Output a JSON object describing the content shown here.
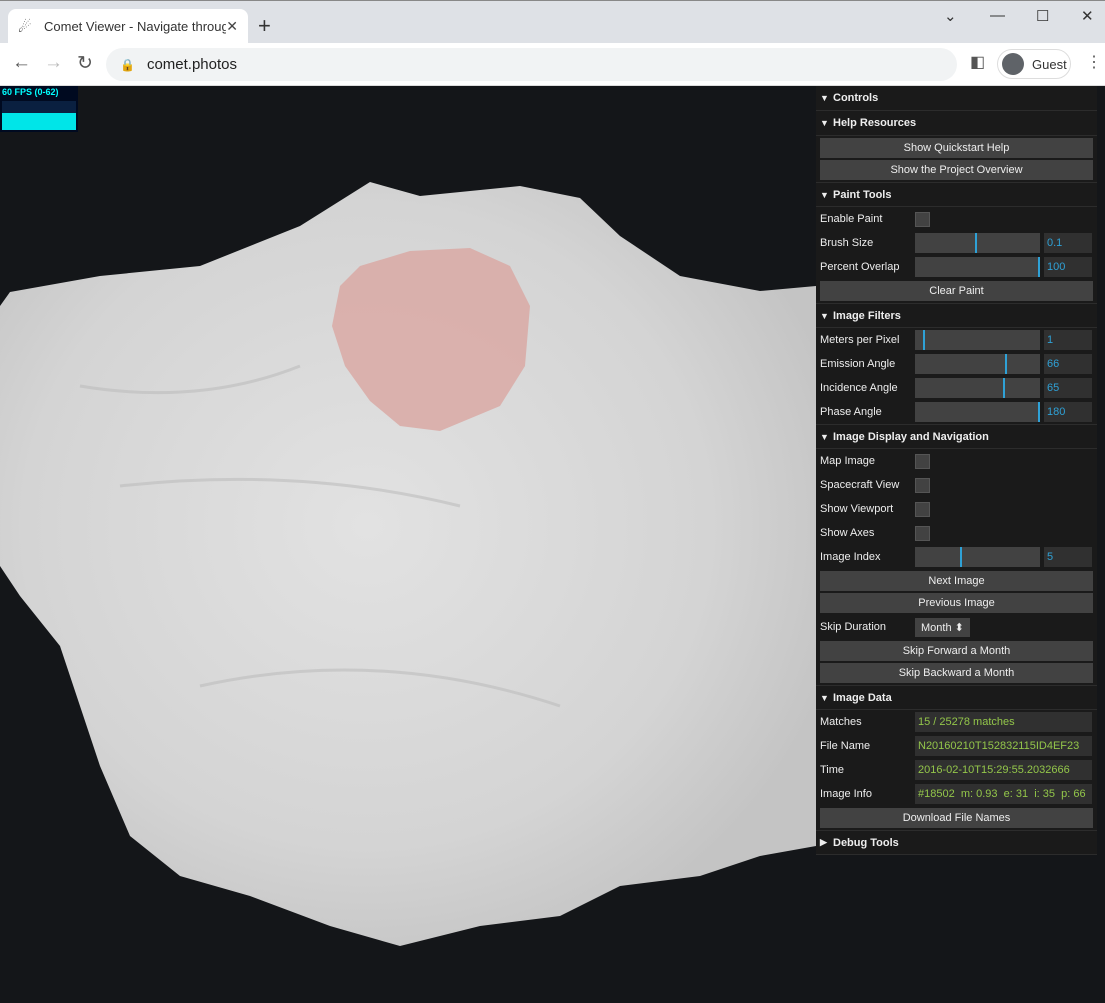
{
  "browser": {
    "tab_title": "Comet Viewer - Navigate through",
    "url": "comet.photos",
    "profile": "Guest"
  },
  "fps": {
    "label": "60 FPS (0-62)"
  },
  "panel": {
    "controls": "Controls",
    "help": {
      "title": "Help Resources",
      "quickstart": "Show Quickstart Help",
      "overview": "Show the Project Overview"
    },
    "paint": {
      "title": "Paint Tools",
      "enable": "Enable Paint",
      "brush_label": "Brush Size",
      "brush_value": "0.1",
      "brush_fraction": 0.48,
      "overlap_label": "Percent Overlap",
      "overlap_value": "100",
      "overlap_fraction": 1.0,
      "clear": "Clear Paint"
    },
    "filters": {
      "title": "Image Filters",
      "mpp_label": "Meters per Pixel",
      "mpp_value": "1",
      "mpp_fraction": 0.06,
      "emission_label": "Emission Angle",
      "emission_value": "66",
      "emission_fraction": 0.72,
      "incidence_label": "Incidence Angle",
      "incidence_value": "65",
      "incidence_fraction": 0.7,
      "phase_label": "Phase Angle",
      "phase_value": "180",
      "phase_fraction": 1.0
    },
    "display": {
      "title": "Image Display and Navigation",
      "map": "Map Image",
      "spacecraft": "Spacecraft View",
      "viewport": "Show Viewport",
      "axes": "Show Axes",
      "index_label": "Image Index",
      "index_value": "5",
      "index_fraction": 0.36,
      "next": "Next Image",
      "prev": "Previous Image",
      "skip_label": "Skip Duration",
      "skip_value": "Month",
      "skip_fwd": "Skip Forward a Month",
      "skip_back": "Skip Backward a Month"
    },
    "data": {
      "title": "Image Data",
      "matches_label": "Matches",
      "matches": "15 / 25278 matches",
      "file_label": "File Name",
      "file": "N20160210T152832115ID4EF23",
      "time_label": "Time",
      "time": "2016-02-10T15:29:55.2032666",
      "info_label": "Image Info",
      "info": "#18502  m: 0.93  e: 31  i: 35  p: 66",
      "download": "Download File Names"
    },
    "debug": "Debug Tools"
  }
}
